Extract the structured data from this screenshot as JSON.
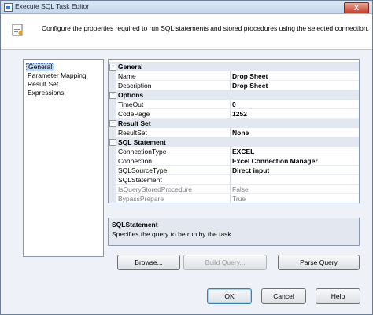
{
  "window": {
    "title": "Execute SQL Task Editor",
    "close_glyph": "X"
  },
  "header": {
    "text": "Configure the properties required to run SQL statements and stored procedures using the selected connection."
  },
  "nav": {
    "items": [
      {
        "label": "General",
        "selected": true
      },
      {
        "label": "Parameter Mapping"
      },
      {
        "label": "Result Set"
      },
      {
        "label": "Expressions"
      }
    ]
  },
  "grid": {
    "rows": [
      {
        "type": "category",
        "name": "General",
        "toggle": "⊟"
      },
      {
        "type": "prop",
        "name": "Name",
        "value": "Drop Sheet"
      },
      {
        "type": "prop",
        "name": "Description",
        "value": "Drop Sheet"
      },
      {
        "type": "category",
        "name": "Options",
        "toggle": "⊟"
      },
      {
        "type": "prop",
        "name": "TimeOut",
        "value": "0"
      },
      {
        "type": "prop",
        "name": "CodePage",
        "value": "1252"
      },
      {
        "type": "category",
        "name": "Result Set",
        "toggle": "⊟"
      },
      {
        "type": "prop",
        "name": "ResultSet",
        "value": "None"
      },
      {
        "type": "category",
        "name": "SQL Statement",
        "toggle": "⊟"
      },
      {
        "type": "prop",
        "name": "ConnectionType",
        "value": "EXCEL"
      },
      {
        "type": "prop",
        "name": "Connection",
        "value": "Excel Connection Manager"
      },
      {
        "type": "prop",
        "name": "SQLSourceType",
        "value": "Direct input"
      },
      {
        "type": "prop",
        "name": "SQLStatement",
        "value": ""
      },
      {
        "type": "prop",
        "name": "IsQueryStoredProcedure",
        "value": "False",
        "disabled": true
      },
      {
        "type": "prop",
        "name": "BypassPrepare",
        "value": "True",
        "disabled": true
      }
    ]
  },
  "description": {
    "title": "SQLStatement",
    "text": "Specifies the query to be run by the task."
  },
  "buttons": {
    "browse": "Browse...",
    "build_query": "Build Query...",
    "parse_query": "Parse Query",
    "ok": "OK",
    "cancel": "Cancel",
    "help": "Help"
  }
}
